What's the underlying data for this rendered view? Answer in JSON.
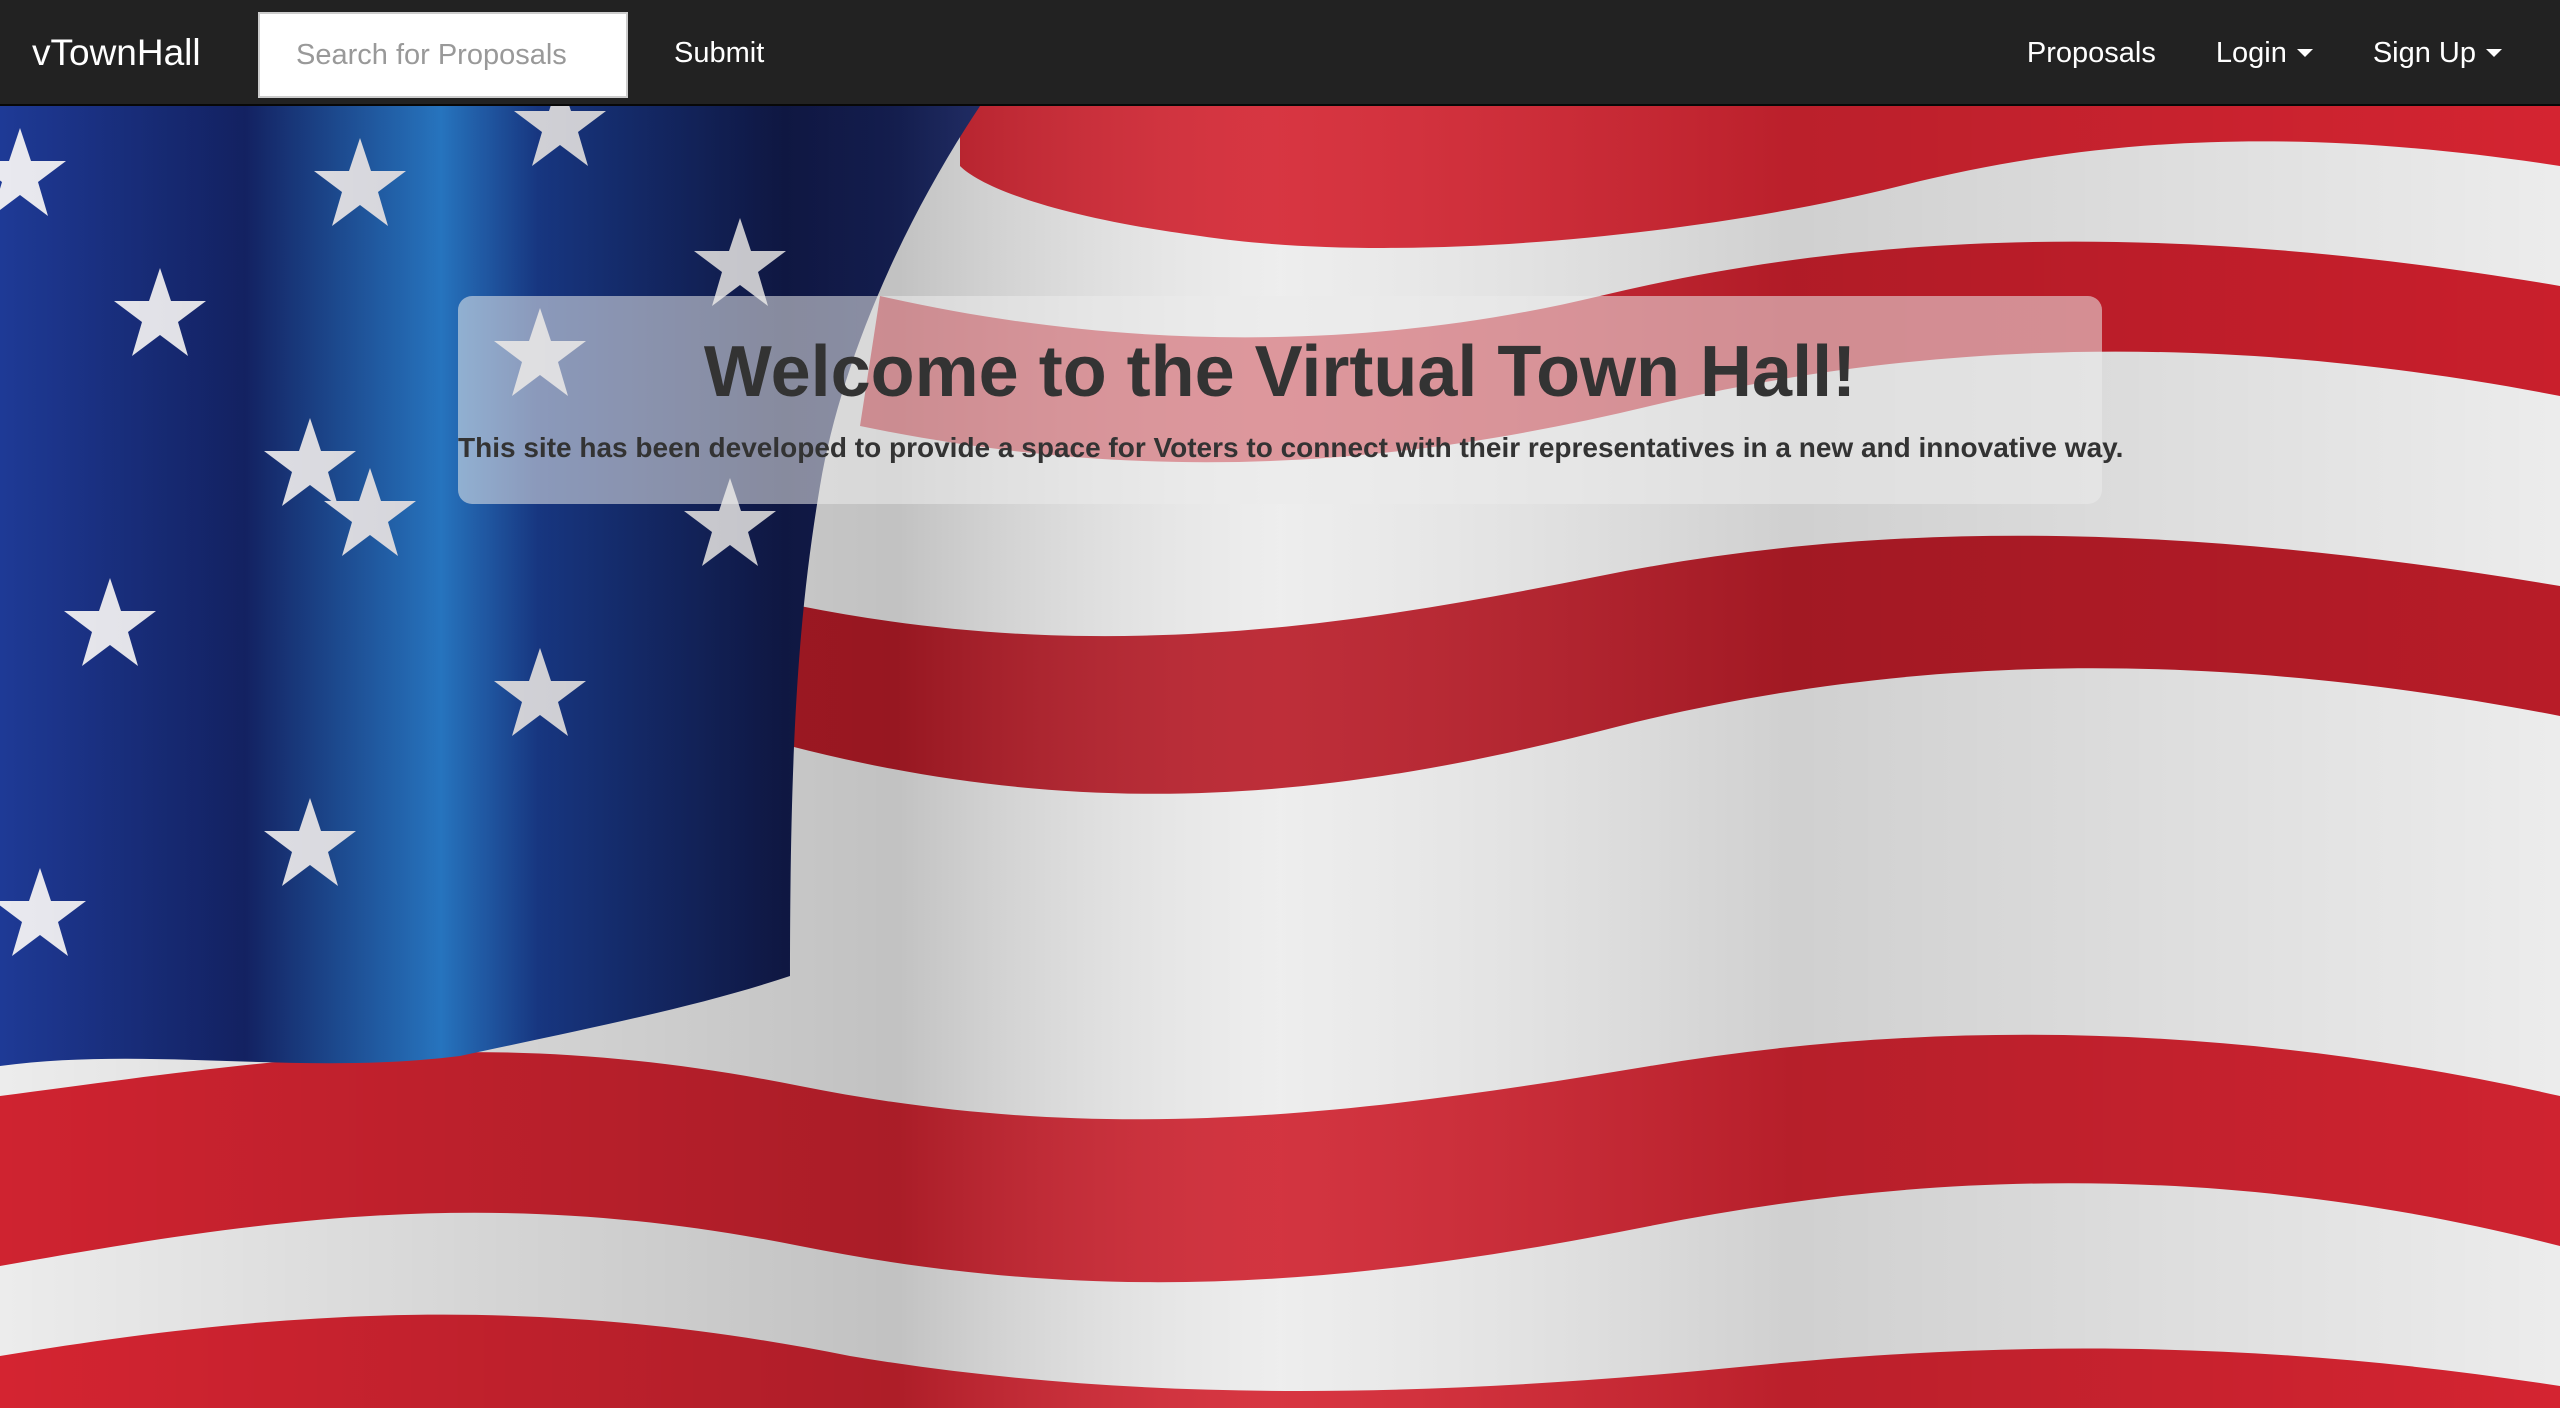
{
  "navbar": {
    "brand": "vTownHall",
    "search": {
      "placeholder": "Search for Proposals",
      "value": ""
    },
    "submit_label": "Submit",
    "right_items": [
      {
        "label": "Proposals",
        "dropdown": false
      },
      {
        "label": "Login",
        "dropdown": true
      },
      {
        "label": "Sign Up",
        "dropdown": true
      }
    ]
  },
  "hero": {
    "background": "american-flag-image",
    "title": "Welcome to the Virtual Town Hall!",
    "subtitle": "This site has been developed to provide a space for Voters to connect with their representatives in a new and innovative way."
  },
  "colors": {
    "navbar_bg": "#222222",
    "flag_red": "#d8222e",
    "flag_white": "#f2f2f2",
    "flag_blue": "#1c2a6b",
    "text_dark": "#333333"
  }
}
